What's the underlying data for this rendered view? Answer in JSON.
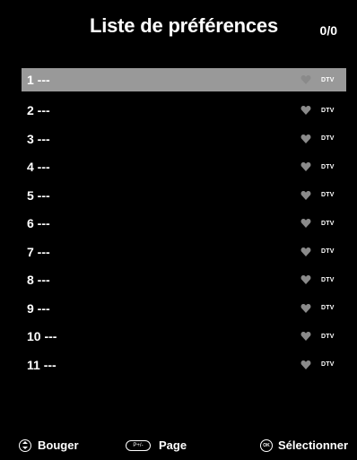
{
  "header": {
    "title": "Liste de préférences",
    "count": "0/0"
  },
  "list": {
    "items": [
      {
        "label": "1 ---",
        "tag": "DTV",
        "selected": true
      },
      {
        "label": "2 ---",
        "tag": "DTV"
      },
      {
        "label": "3 ---",
        "tag": "DTV"
      },
      {
        "label": "4 ---",
        "tag": "DTV"
      },
      {
        "label": "5 ---",
        "tag": "DTV"
      },
      {
        "label": "6 ---",
        "tag": "DTV"
      },
      {
        "label": "7 ---",
        "tag": "DTV"
      },
      {
        "label": "8 ---",
        "tag": "DTV"
      },
      {
        "label": "9 ---",
        "tag": "DTV"
      },
      {
        "label": "10 ---",
        "tag": "DTV"
      },
      {
        "label": "11 ---",
        "tag": "DTV"
      }
    ]
  },
  "footer": {
    "move_label": "Bouger",
    "page_key": "P+/-",
    "page_label": "Page",
    "ok_key": "OK",
    "select_label": "Sélectionner"
  },
  "colors": {
    "background": "#000000",
    "selected_row": "#999999",
    "heart": "#8a8a8a",
    "text": "#ffffff"
  },
  "icons": {
    "favorite": "heart-icon",
    "move": "up-down-arrows-icon"
  }
}
